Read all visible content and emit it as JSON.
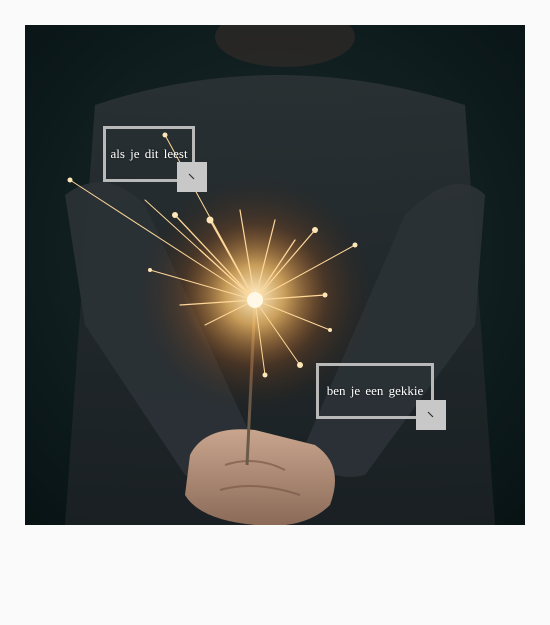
{
  "photo": {
    "subject": "sparkler-held-in-hands",
    "colors": {
      "background": "#0d1b1c",
      "sweater": "#2e3336",
      "spark": "#ffd79a",
      "skin": "#d9b9a3"
    }
  },
  "captions": [
    {
      "text": "als je dit leest"
    },
    {
      "text": "ben je een gekkie"
    }
  ],
  "handles": [
    {
      "icon": "resize-icon"
    },
    {
      "icon": "resize-icon"
    }
  ],
  "colors": {
    "page_background": "#fafafa",
    "box_border": "#b9b9b9",
    "handle_fill": "#c8c8c8",
    "caption_text": "#ffffff"
  }
}
